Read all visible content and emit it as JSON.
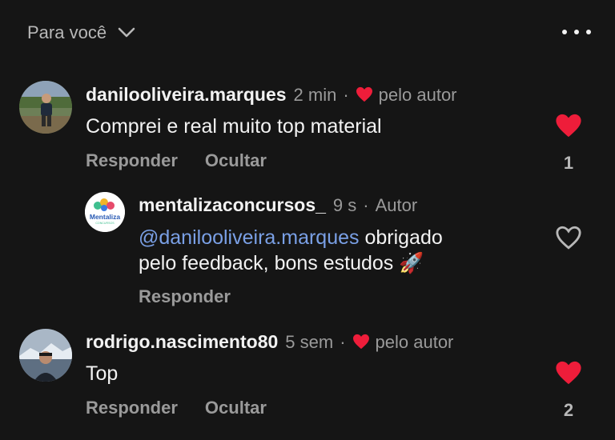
{
  "header": {
    "sort_label": "Para você"
  },
  "colors": {
    "background": "#151515",
    "heart": "#ee1d3a",
    "mention": "#7aa0e6",
    "muted": "#9a9a9a"
  },
  "comments": [
    {
      "username": "danilooliveira.marques",
      "time": "2 min",
      "separator": "·",
      "author_tag": "pelo autor",
      "text": "Comprei e real muito top material",
      "reply_label": "Responder",
      "hide_label": "Ocultar",
      "liked": true,
      "like_count": "1"
    },
    {
      "username": "mentalizaconcursos_",
      "time": "9 s",
      "separator": "·",
      "author_tag": "Autor",
      "mention": "@danilooliveira.marques",
      "text_line1": " obrigado",
      "text_line2": "pelo feedback, bons estudos",
      "emoji": "🚀",
      "avatar_logo": "Mentaliza",
      "avatar_logo_sub": "CONCURSOS",
      "reply_label": "Responder",
      "liked": false
    },
    {
      "username": "rodrigo.nascimento80",
      "time": "5 sem",
      "separator": "·",
      "author_tag": "pelo autor",
      "text": "Top",
      "reply_label": "Responder",
      "hide_label": "Ocultar",
      "liked": true,
      "like_count": "2"
    }
  ]
}
